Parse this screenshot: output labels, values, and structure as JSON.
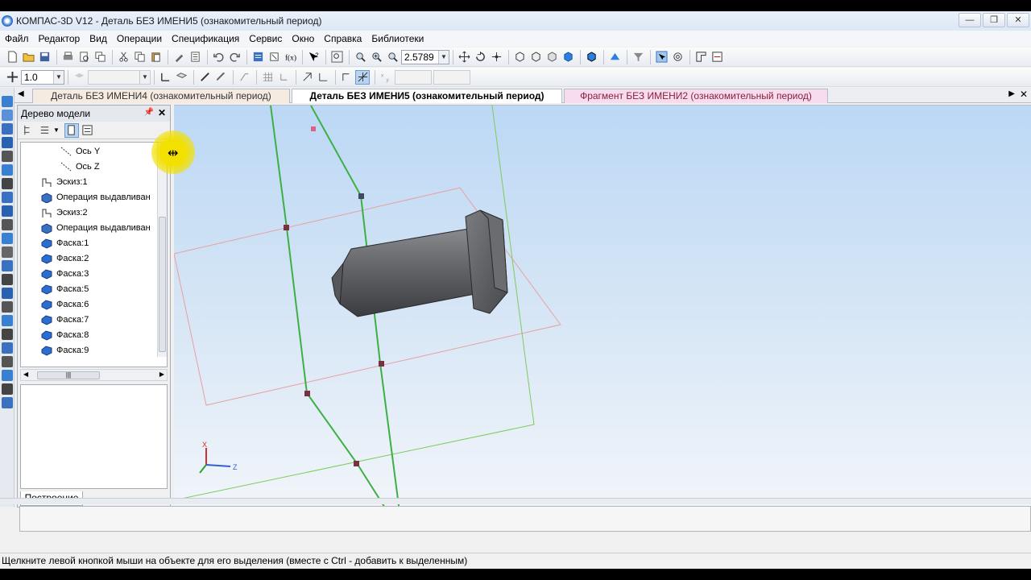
{
  "window": {
    "title": "КОМПАС-3D V12 - Деталь БЕЗ ИМЕНИ5 (ознакомительный период)",
    "buttons": [
      "—",
      "❐",
      "✕"
    ]
  },
  "menu": [
    "Файл",
    "Редактор",
    "Вид",
    "Операции",
    "Спецификация",
    "Сервис",
    "Окно",
    "Справка",
    "Библиотеки"
  ],
  "toolbar": {
    "zoom_value": "2.5789",
    "step_value": "1.0"
  },
  "doc_tabs": [
    "Деталь БЕЗ ИМЕНИ4 (ознакомительный период)",
    "Деталь БЕЗ ИМЕНИ5 (ознакомительный период)",
    "Фрагмент БЕЗ ИМЕНИ2 (ознакомительный период)"
  ],
  "tree_panel": {
    "title": "Дерево модели",
    "tab_label": "Построение",
    "items": [
      {
        "label": "Ось Y",
        "kind": "axis"
      },
      {
        "label": "Ось Z",
        "kind": "axis"
      },
      {
        "label": "Эскиз:1",
        "kind": "sketch"
      },
      {
        "label": "Операция выдавливан",
        "kind": "extrude"
      },
      {
        "label": "Эскиз:2",
        "kind": "sketch"
      },
      {
        "label": "Операция выдавливан",
        "kind": "extrude"
      },
      {
        "label": "Фаска:1",
        "kind": "chamfer"
      },
      {
        "label": "Фаска:2",
        "kind": "chamfer"
      },
      {
        "label": "Фаска:3",
        "kind": "chamfer"
      },
      {
        "label": "Фаска:5",
        "kind": "chamfer"
      },
      {
        "label": "Фаска:6",
        "kind": "chamfer"
      },
      {
        "label": "Фаска:7",
        "kind": "chamfer"
      },
      {
        "label": "Фаска:8",
        "kind": "chamfer"
      },
      {
        "label": "Фаска:9",
        "kind": "chamfer"
      }
    ]
  },
  "viewport": {
    "triad": {
      "x": "X",
      "z": "Z"
    }
  },
  "status_text": "Щелкните левой кнопкой мыши на объекте для его выделения (вместе с Ctrl - добавить к выделенным)",
  "colors": {
    "accent": "#2a6fc9",
    "tab_active": "#ffffff",
    "tab_fragment": "#f6dcec",
    "viewport_top": "#bcd8f5",
    "plane_green": "#3cb043",
    "plane_red": "#e8a0a0",
    "cursor_highlight": "#f2e000"
  }
}
